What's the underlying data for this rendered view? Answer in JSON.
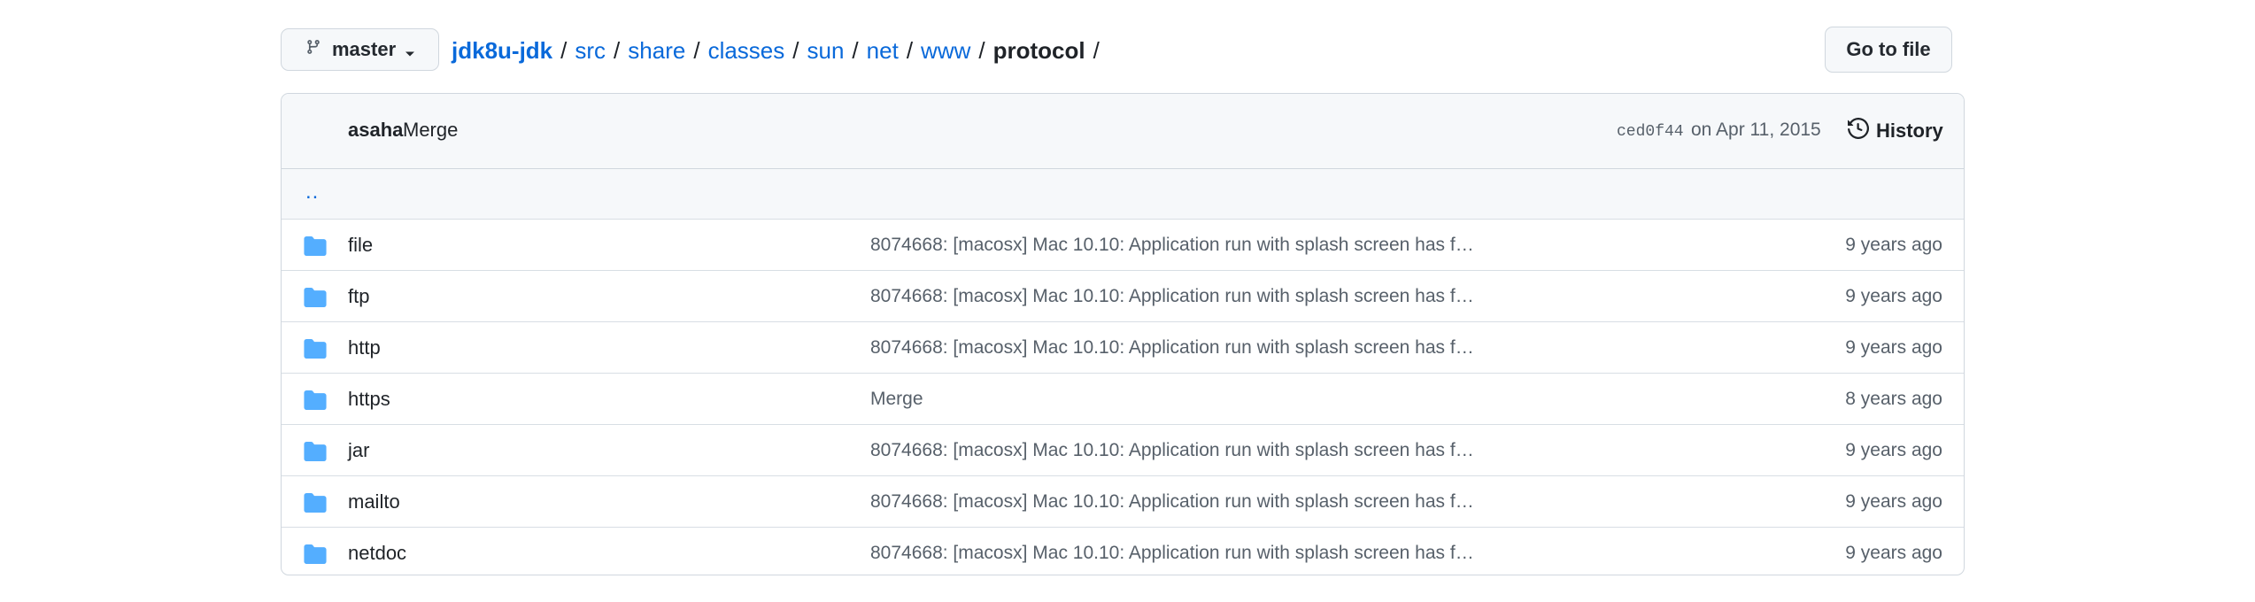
{
  "branch": {
    "name": "master"
  },
  "breadcrumb": [
    {
      "label": "jdk8u-jdk",
      "kind": "repo"
    },
    {
      "label": "src",
      "kind": "link"
    },
    {
      "label": "share",
      "kind": "link"
    },
    {
      "label": "classes",
      "kind": "link"
    },
    {
      "label": "sun",
      "kind": "link"
    },
    {
      "label": "net",
      "kind": "link"
    },
    {
      "label": "www",
      "kind": "link"
    },
    {
      "label": "protocol",
      "kind": "current"
    }
  ],
  "breadcrumb_sep": "/",
  "goto_file_label": "Go to file",
  "latest_commit": {
    "author": "asaha",
    "message": "Merge",
    "sha": "ced0f44",
    "date": "on Apr 11, 2015",
    "history_label": "History"
  },
  "parent_dir_label": "..",
  "files": [
    {
      "name": "file",
      "message": "8074668: [macosx] Mac 10.10: Application run with splash screen has f…",
      "age": "9 years ago"
    },
    {
      "name": "ftp",
      "message": "8074668: [macosx] Mac 10.10: Application run with splash screen has f…",
      "age": "9 years ago"
    },
    {
      "name": "http",
      "message": "8074668: [macosx] Mac 10.10: Application run with splash screen has f…",
      "age": "9 years ago"
    },
    {
      "name": "https",
      "message": "Merge",
      "age": "8 years ago"
    },
    {
      "name": "jar",
      "message": "8074668: [macosx] Mac 10.10: Application run with splash screen has f…",
      "age": "9 years ago"
    },
    {
      "name": "mailto",
      "message": "8074668: [macosx] Mac 10.10: Application run with splash screen has f…",
      "age": "9 years ago"
    },
    {
      "name": "netdoc",
      "message": "8074668: [macosx] Mac 10.10: Application run with splash screen has f…",
      "age": "9 years ago"
    }
  ],
  "icons": {
    "branch": "git-branch-icon",
    "caret": "caret-down-icon",
    "history": "history-clock-icon",
    "folder": "folder-icon"
  },
  "colors": {
    "link": "#0969da",
    "folder": "#54aeff",
    "muted": "#57606a",
    "border": "#d0d7de",
    "header_bg": "#f6f8fa"
  }
}
